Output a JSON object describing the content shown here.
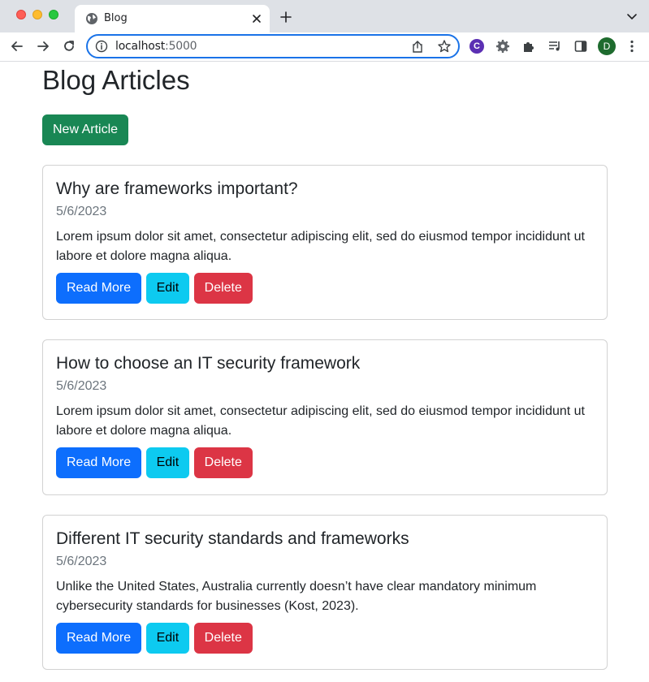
{
  "browser": {
    "tab_title": "Blog",
    "url_host": "localhost",
    "url_port": ":5000",
    "profile_initial": "D",
    "extension_initial": "C"
  },
  "page": {
    "title": "Blog Articles",
    "new_article_label": "New Article"
  },
  "articles": [
    {
      "title": "Why are frameworks important?",
      "date": "5/6/2023",
      "excerpt": "Lorem ipsum dolor sit amet, consectetur adipiscing elit, sed do eiusmod tempor incididunt ut labore et dolore magna aliqua.",
      "read_label": "Read More",
      "edit_label": "Edit",
      "delete_label": "Delete"
    },
    {
      "title": "How to choose an IT security framework",
      "date": "5/6/2023",
      "excerpt": "Lorem ipsum dolor sit amet, consectetur adipiscing elit, sed do eiusmod tempor incididunt ut labore et dolore magna aliqua.",
      "read_label": "Read More",
      "edit_label": "Edit",
      "delete_label": "Delete"
    },
    {
      "title": "Different IT security standards and frameworks",
      "date": "5/6/2023",
      "excerpt": "Unlike the United States, Australia currently doesn’t have clear mandatory minimum cybersecurity standards for businesses (Kost, 2023).",
      "read_label": "Read More",
      "edit_label": "Edit",
      "delete_label": "Delete"
    }
  ],
  "icons": {
    "favicon": "globe-icon",
    "tab_close": "close-icon",
    "new_tab": "plus-icon",
    "tab_search": "chevron-down-icon",
    "back": "arrow-left-icon",
    "forward": "arrow-right-icon",
    "reload": "reload-icon",
    "site_info": "info-icon",
    "share": "share-icon",
    "bookmark": "star-icon",
    "settings_ext": "gear-icon",
    "extensions": "puzzle-icon",
    "media": "media-queue-icon",
    "side_panel": "side-panel-icon",
    "menu": "kebab-menu-icon"
  },
  "colors": {
    "success": "#198754",
    "primary": "#0d6efd",
    "info": "#0dcaf0",
    "danger": "#dc3545",
    "focus_ring": "#1a73e8"
  }
}
